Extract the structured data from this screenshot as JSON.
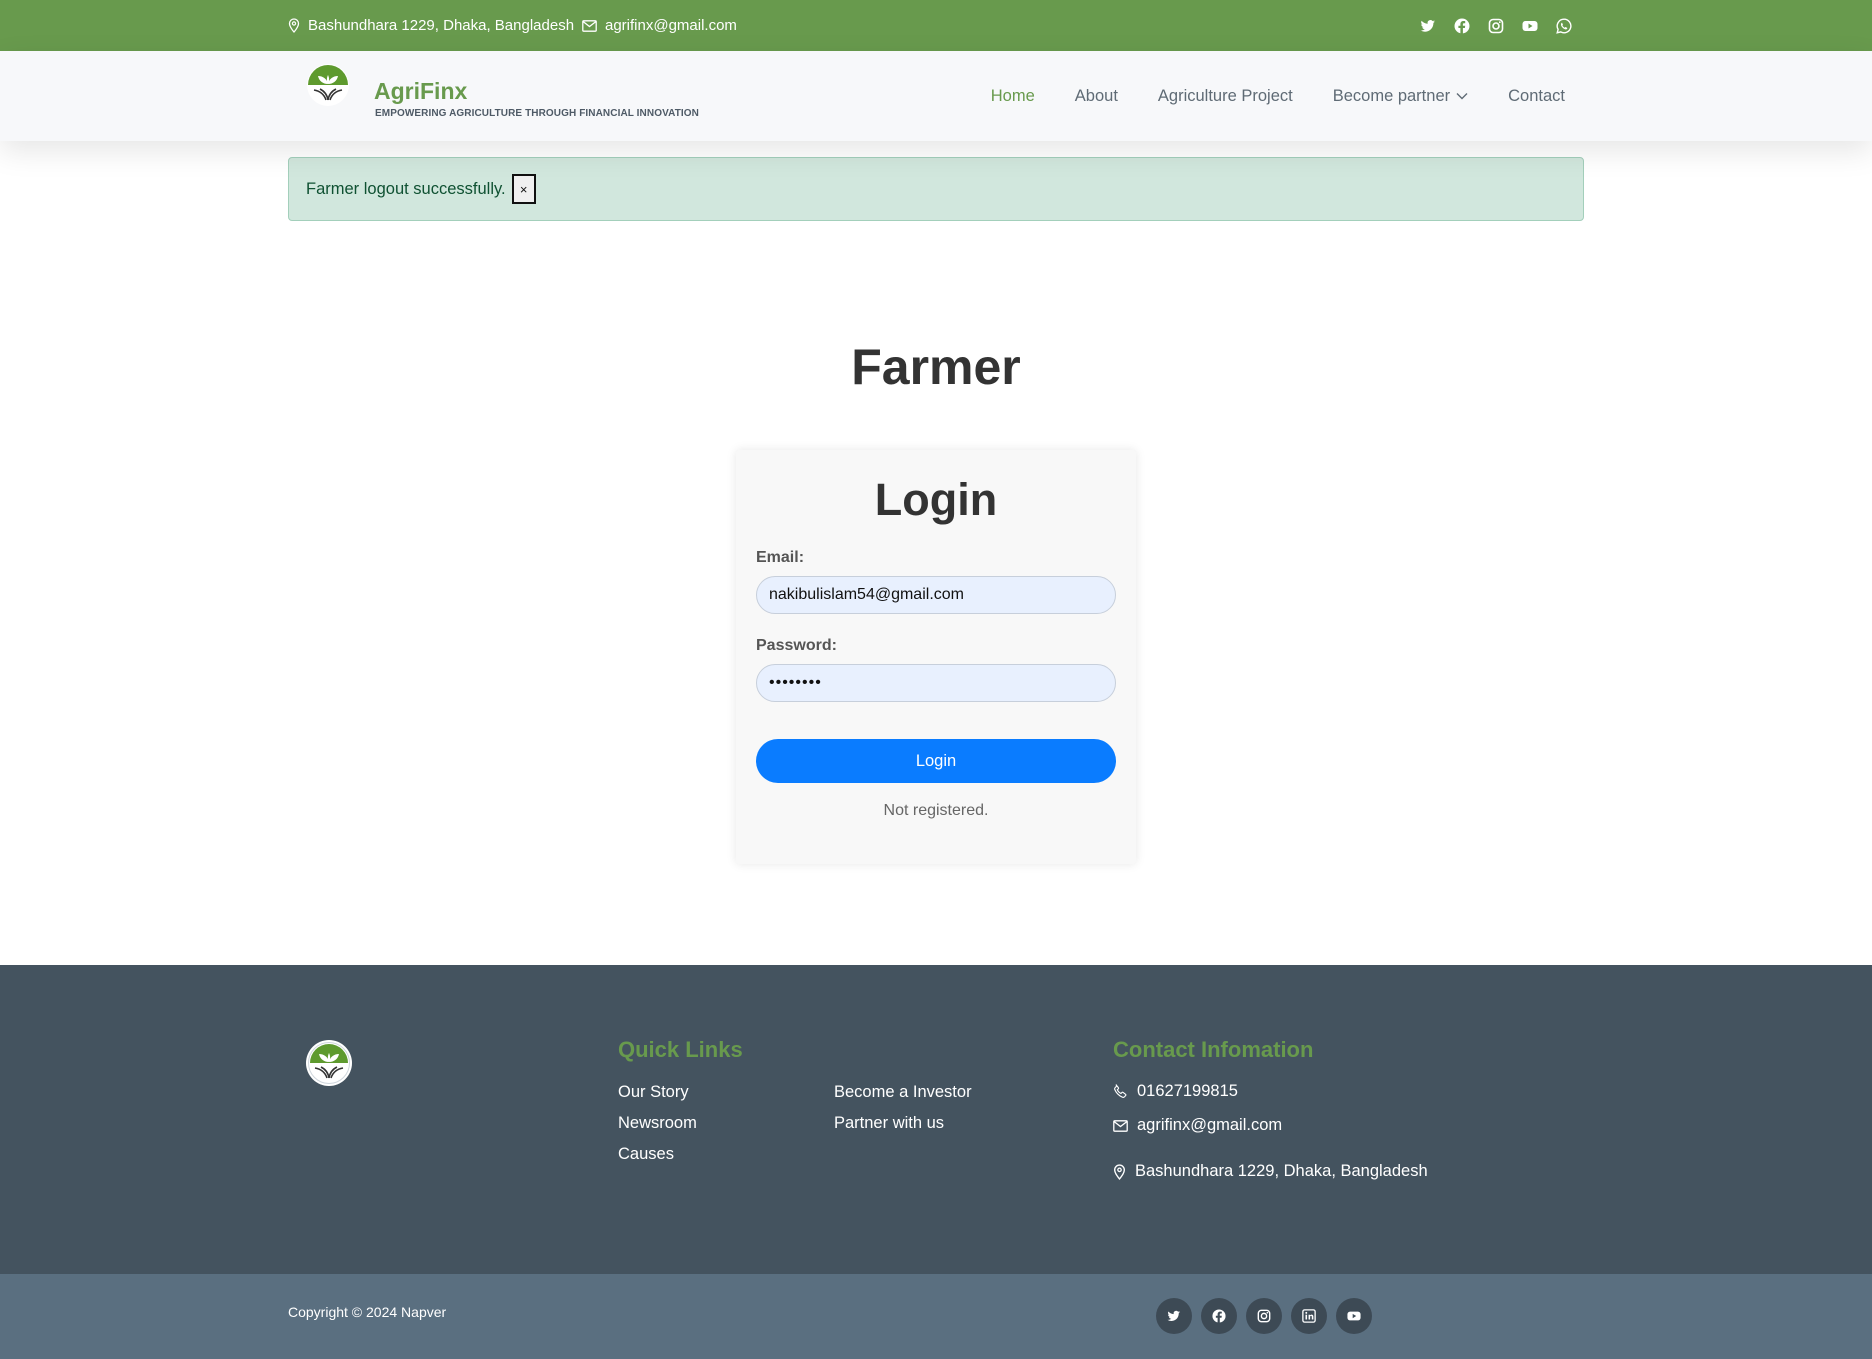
{
  "topbar": {
    "address": "Bashundhara 1229, Dhaka, Bangladesh",
    "email": "agrifinx@gmail.com",
    "social_icons": [
      "twitter-icon",
      "facebook-icon",
      "instagram-icon",
      "youtube-icon",
      "whatsapp-icon"
    ]
  },
  "header": {
    "brand": "AgriFinx",
    "tagline": "EMPOWERING AGRICULTURE THROUGH FINANCIAL INNOVATION",
    "nav": [
      {
        "label": "Home",
        "active": true
      },
      {
        "label": "About"
      },
      {
        "label": "Agriculture Project"
      },
      {
        "label": "Become partner",
        "dropdown": true
      },
      {
        "label": "Contact"
      }
    ]
  },
  "alert": {
    "message": "Farmer logout successfully.",
    "close": "×"
  },
  "main": {
    "title": "Farmer",
    "login": {
      "title": "Login",
      "email_label": "Email:",
      "email_value": "nakibulislam54@gmail.com",
      "password_label": "Password:",
      "password_value": "••••••••",
      "button": "Login",
      "register_text": "Not registered."
    }
  },
  "footer": {
    "quick_links_title": "Quick Links",
    "quick_links": [
      "Our Story",
      "Newsroom",
      "Causes",
      "Become a Investor",
      "Partner with us"
    ],
    "contact_title": "Contact Infomation",
    "phone": "01627199815",
    "email": "agrifinx@gmail.com",
    "address": "Bashundhara 1229, Dhaka, Bangladesh",
    "copyright": "Copyright © 2024 Napver",
    "social_icons": [
      "twitter-icon",
      "facebook-icon",
      "instagram-icon",
      "linkedin-icon",
      "youtube-icon"
    ]
  },
  "colors": {
    "brand_green": "#689a4d",
    "footer_dark": "#44535f",
    "footer_bottom": "#5a6f80",
    "primary_button": "#0a7cff",
    "alert_bg": "#d1e7dd"
  }
}
